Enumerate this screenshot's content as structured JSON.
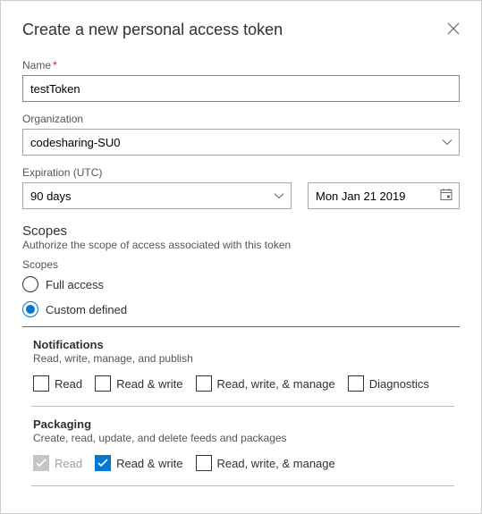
{
  "title": "Create a new personal access token",
  "fields": {
    "name": {
      "label": "Name",
      "value": "testToken"
    },
    "organization": {
      "label": "Organization",
      "value": "codesharing-SU0"
    },
    "expiration": {
      "label": "Expiration (UTC)",
      "days": "90 days",
      "date": "Mon Jan 21 2019"
    }
  },
  "scopes": {
    "title": "Scopes",
    "description": "Authorize the scope of access associated with this token",
    "sub_label": "Scopes",
    "options": {
      "full": "Full access",
      "custom": "Custom defined"
    }
  },
  "groups": {
    "notifications": {
      "name": "Notifications",
      "description": "Read, write, manage, and publish",
      "checks": {
        "read": "Read",
        "read_write": "Read & write",
        "read_write_manage": "Read, write, & manage",
        "diagnostics": "Diagnostics"
      }
    },
    "packaging": {
      "name": "Packaging",
      "description": "Create, read, update, and delete feeds and packages",
      "checks": {
        "read": "Read",
        "read_write": "Read & write",
        "read_write_manage": "Read, write, & manage"
      }
    }
  }
}
